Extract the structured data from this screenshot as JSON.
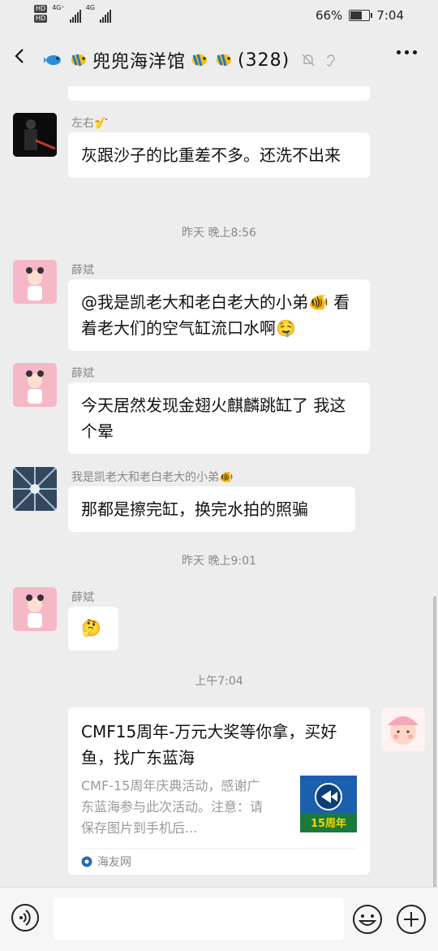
{
  "status_bar": {
    "battery": "66%",
    "battery_level": 0.66,
    "time": "7:04",
    "network_1": "4G⁺",
    "network_2": "4G",
    "hd_1": "HD",
    "hd_2": "HD"
  },
  "header": {
    "title_text": "兜兜海洋馆",
    "count": "(328)"
  },
  "messages": [
    {
      "sender": "左右🎷",
      "text": "灰跟沙子的比重差不多。还洗不出来"
    },
    {
      "time": "昨天 晚上8:56"
    },
    {
      "sender": "薛斌",
      "text": "@我是凯老大和老白老大的小弟🐠 看着老大们的空气缸流口水啊🤤"
    },
    {
      "sender": "薛斌",
      "text": "今天居然发现金翅火麒麟跳缸了 我这个晕"
    },
    {
      "sender": "我是凯老大和老白老大的小弟🐠",
      "text": "那都是擦完缸，换完水拍的照骗"
    },
    {
      "time": "昨天 晚上9:01"
    },
    {
      "sender": "薛斌",
      "text": "🤔"
    },
    {
      "time": "上午7:04"
    }
  ],
  "link_card": {
    "title": "CMF15周年-万元大奖等你拿，买好鱼，找广东蓝海",
    "description": "CMF-15周年庆典活动，感谢广东蓝海参与此次活动。注意：请保存图片到手机后...",
    "thumb_text": "15周年",
    "source": "海友网"
  },
  "input": {
    "placeholder": ""
  }
}
